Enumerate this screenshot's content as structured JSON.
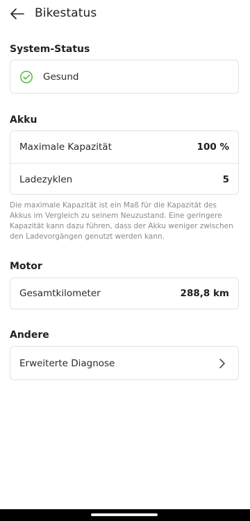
{
  "header": {
    "title": "Bikestatus"
  },
  "system_status": {
    "title": "System-Status",
    "status_label": "Gesund",
    "status_color": "#5bb846"
  },
  "battery": {
    "title": "Akku",
    "max_capacity_label": "Maximale Kapazität",
    "max_capacity_value": "100 %",
    "charge_cycles_label": "Ladezyklen",
    "charge_cycles_value": "5",
    "note": "Die maximale Kapazität ist ein Maß für die Kapazität des Akkus im Vergleich zu seinem Neuzustand. Eine geringere Kapazität kann dazu führen, dass der Akku weniger zwischen den Ladevorgängen genutzt werden kann."
  },
  "motor": {
    "title": "Motor",
    "total_km_label": "Gesamtkilometer",
    "total_km_value": "288,8 km"
  },
  "other": {
    "title": "Andere",
    "advanced_diagnosis_label": "Erweiterte Diagnose"
  }
}
